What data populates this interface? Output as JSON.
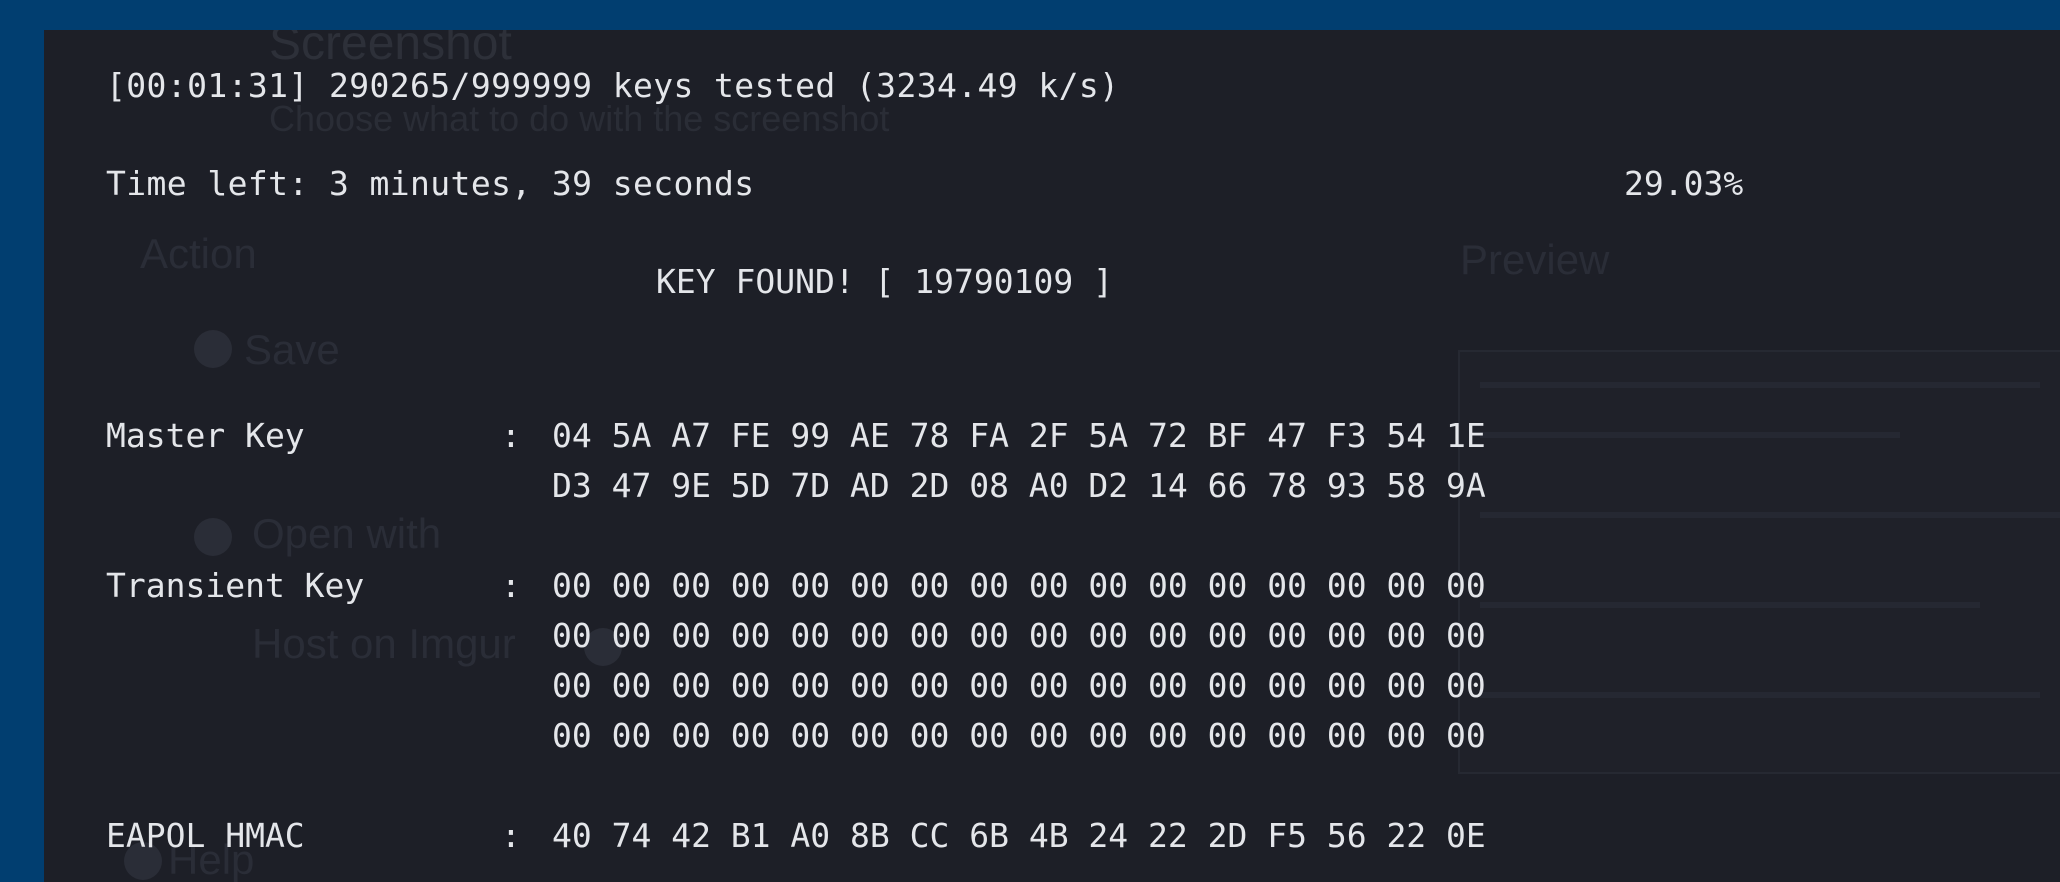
{
  "progress": {
    "status_line": "[00:01:31] 290265/999999 keys tested (3234.49 k/s)",
    "time_left": "Time left: 3 minutes, 39 seconds",
    "percent": "29.03%",
    "key_found": "KEY FOUND! [ 19790109 ]"
  },
  "keys": {
    "master_key": {
      "label": "Master Key",
      "rows": [
        "04 5A A7 FE 99 AE 78 FA 2F 5A 72 BF 47 F3 54 1E",
        "D3 47 9E 5D 7D AD 2D 08 A0 D2 14 66 78 93 58 9A"
      ]
    },
    "transient_key": {
      "label": "Transient Key",
      "rows": [
        "00 00 00 00 00 00 00 00 00 00 00 00 00 00 00 00",
        "00 00 00 00 00 00 00 00 00 00 00 00 00 00 00 00",
        "00 00 00 00 00 00 00 00 00 00 00 00 00 00 00 00",
        "00 00 00 00 00 00 00 00 00 00 00 00 00 00 00 00"
      ]
    },
    "eapol_hmac": {
      "label": "EAPOL HMAC",
      "rows": [
        "40 74 42 B1 A0 8B CC 6B 4B 24 22 2D F5 56 22 0E"
      ]
    },
    "separator": ":"
  },
  "background_ghost": {
    "title": "Screenshot",
    "subtitle": "Choose what to do with the screenshot",
    "action": "Action",
    "preview": "Preview",
    "save": "Save",
    "open_with": "Open with",
    "host_on": "Host on Imgur",
    "help": "Help"
  },
  "colors": {
    "border_blue": "#013e70",
    "terminal_bg": "#1d1f27",
    "text": "#e4e6ea"
  }
}
